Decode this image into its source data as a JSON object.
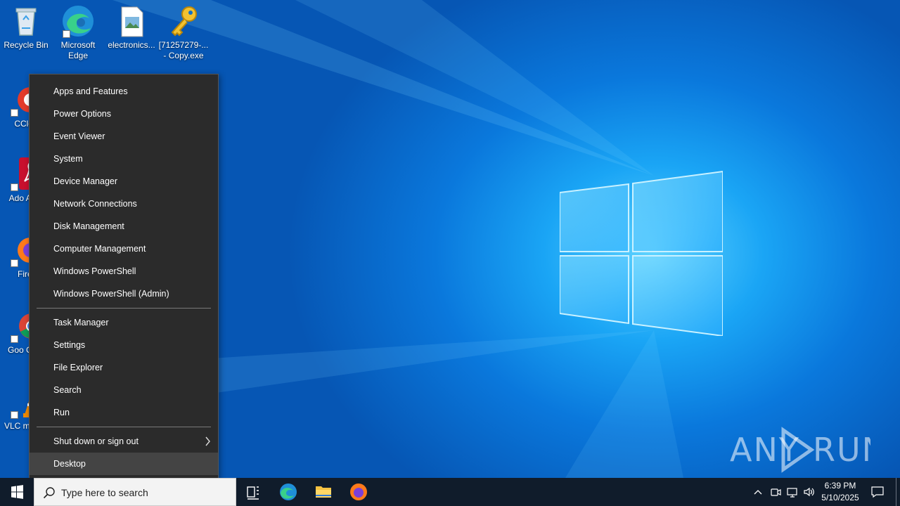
{
  "desktop": {
    "icons": [
      {
        "label": "Recycle Bin",
        "icon": "recycle-bin-icon"
      },
      {
        "label": "Microsoft Edge",
        "icon": "edge-icon"
      },
      {
        "label": "electronics...",
        "icon": "image-file-icon"
      },
      {
        "label": "[71257279-... - Copy.exe",
        "icon": "key-icon"
      },
      {
        "label": "CClea",
        "icon": "ccleaner-icon"
      },
      {
        "label": "Ado Acro",
        "icon": "acrobat-icon"
      },
      {
        "label": "Firef",
        "icon": "firefox-icon"
      },
      {
        "label": "Goo Chro",
        "icon": "chrome-icon"
      },
      {
        "label": "VLC m play",
        "icon": "vlc-icon"
      }
    ]
  },
  "menu": {
    "items": [
      "Apps and Features",
      "Power Options",
      "Event Viewer",
      "System",
      "Device Manager",
      "Network Connections",
      "Disk Management",
      "Computer Management",
      "Windows PowerShell",
      "Windows PowerShell (Admin)",
      "Task Manager",
      "Settings",
      "File Explorer",
      "Search",
      "Run",
      "Shut down or sign out",
      "Desktop"
    ],
    "highlighted": "Desktop"
  },
  "taskbar": {
    "search_placeholder": "Type here to search",
    "time": "6:39 PM",
    "date": "5/10/2025",
    "pinned": [
      "task-view-icon",
      "edge-icon",
      "file-explorer-icon",
      "firefox-icon"
    ]
  },
  "watermark": "ANY RUN",
  "colors": {
    "menu_bg": "#2b2b2b",
    "menu_highlight": "#444444",
    "taskbar_bg": "#101c2b",
    "desktop_blue": "#0a78dc"
  }
}
